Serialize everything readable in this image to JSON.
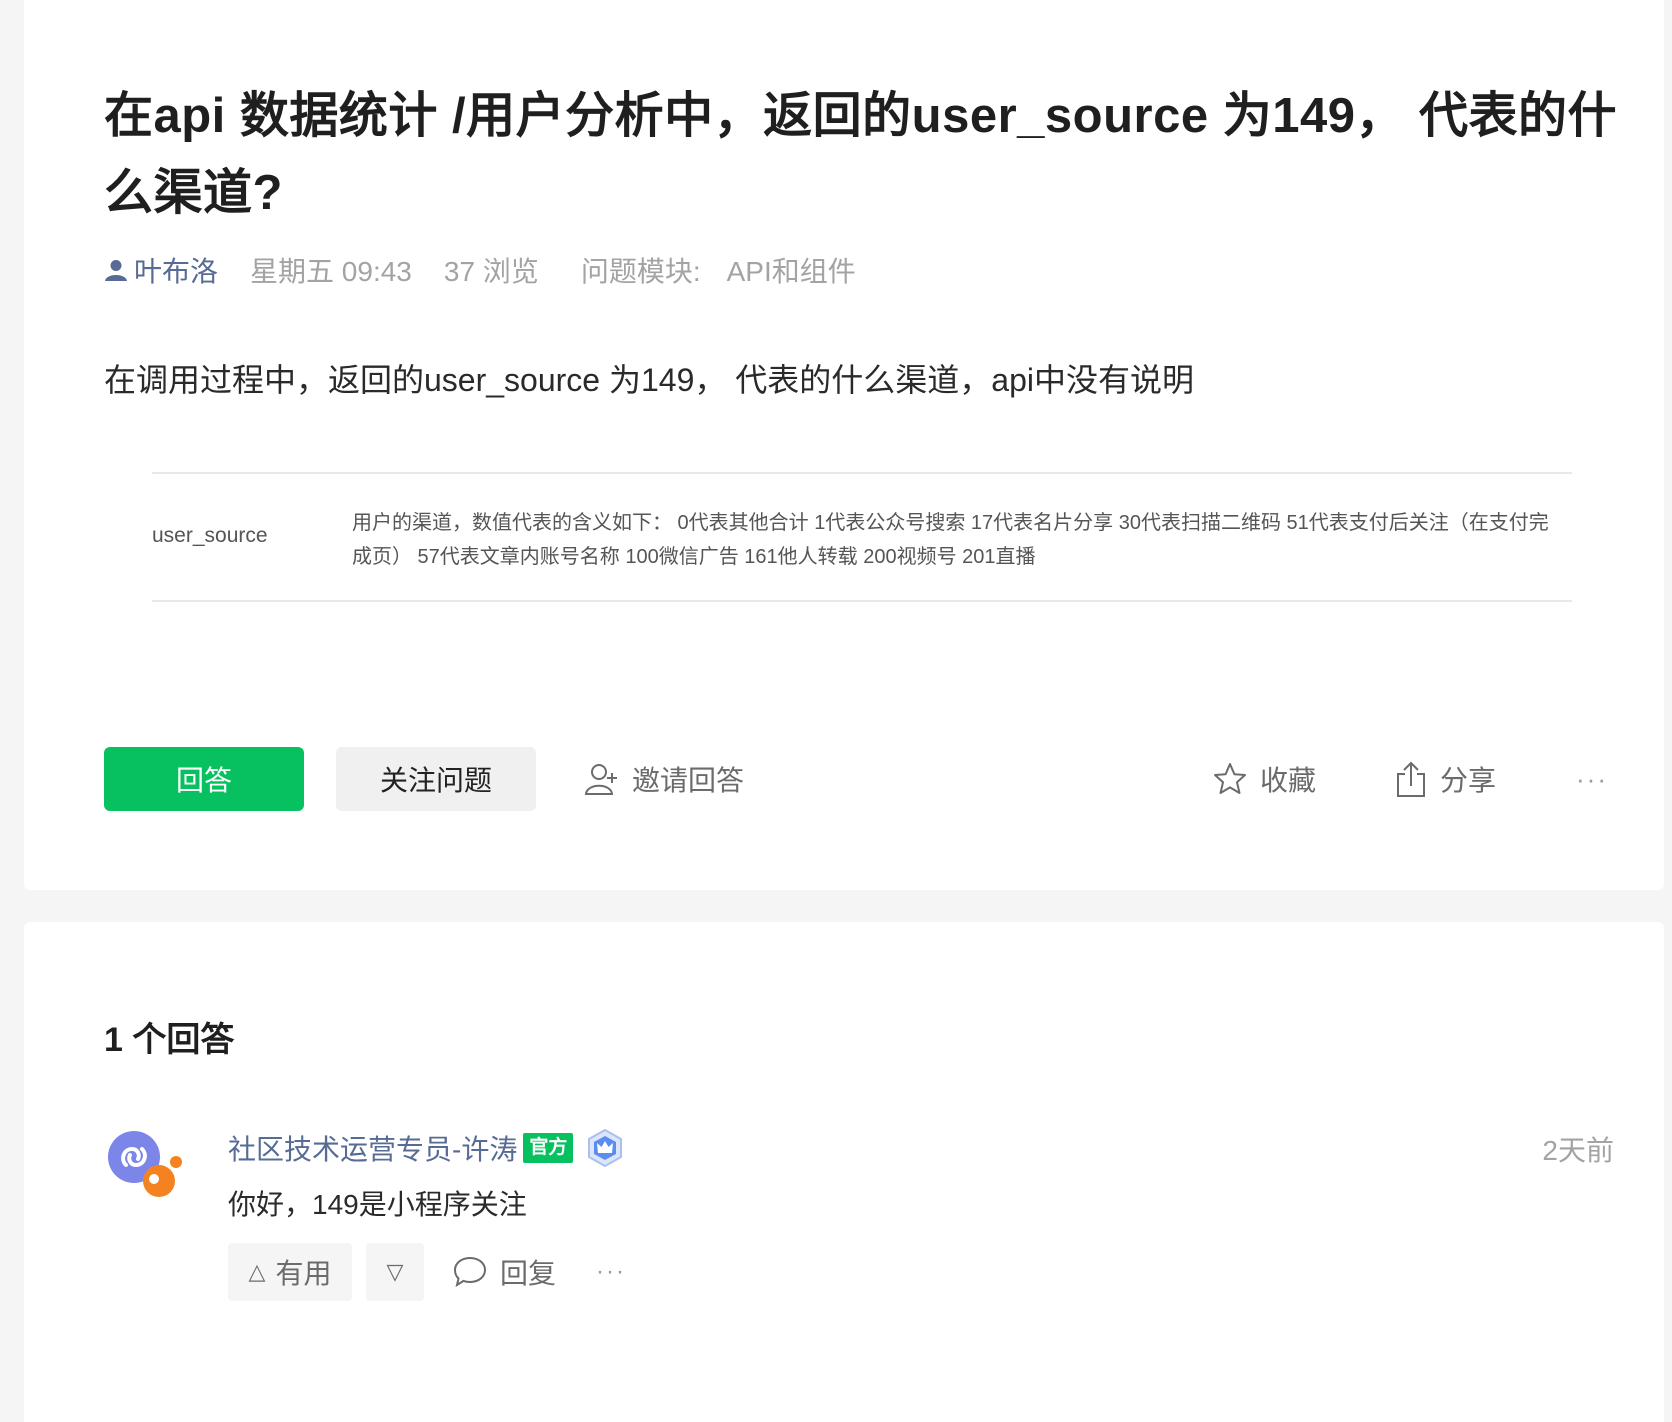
{
  "question": {
    "title": "在api 数据统计 /用户分析中，返回的user_source 为149， 代表的什么渠道?",
    "author": "叶布洛",
    "time": "星期五 09:43",
    "views": "37 浏览",
    "module_label": "问题模块:",
    "module_value": "API和组件",
    "body": "在调用过程中，返回的user_source 为149， 代表的什么渠道，api中没有说明",
    "embed": {
      "field": "user_source",
      "description": "用户的渠道，数值代表的含义如下： 0代表其他合计 1代表公众号搜索 17代表名片分享 30代表扫描二维码 51代表支付后关注（在支付完成页） 57代表文章内账号名称 100微信广告 161他人转载 200视频号 201直播"
    },
    "actions": {
      "answer": "回答",
      "follow": "关注问题",
      "invite": "邀请回答",
      "collect": "收藏",
      "share": "分享",
      "more": "···"
    }
  },
  "answers": {
    "count_label": "1 个回答",
    "items": [
      {
        "author": "社区技术运营专员-许涛",
        "badge": "官方",
        "time": "2天前",
        "text": "你好，149是小程序关注",
        "useful_label": "有用",
        "reply_label": "回复",
        "more": "···"
      }
    ]
  },
  "colors": {
    "accent_green": "#07c160",
    "link_blue": "#576b95"
  }
}
